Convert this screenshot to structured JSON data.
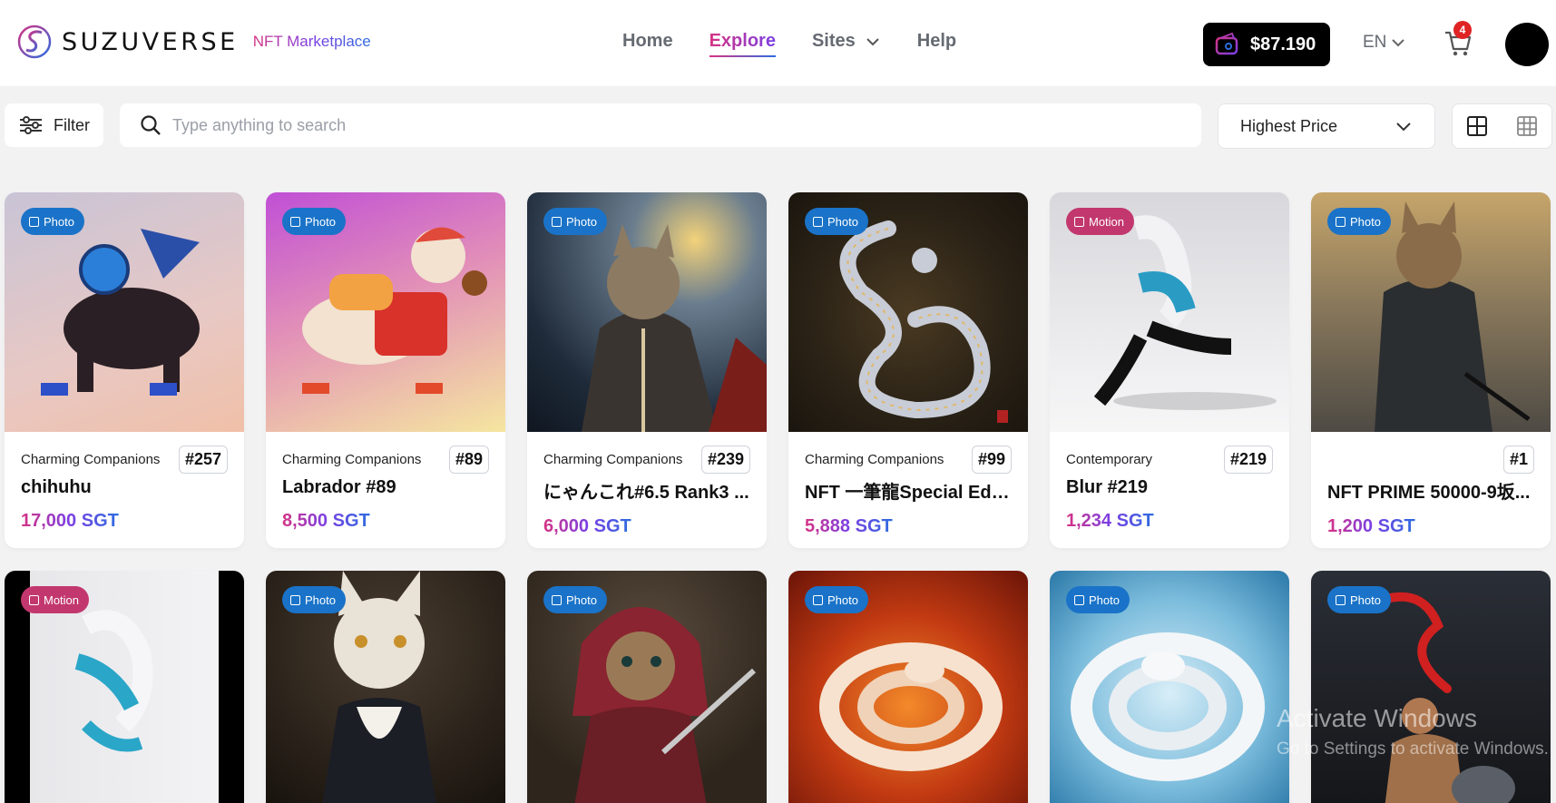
{
  "header": {
    "brand": "SUZUVERSE",
    "brand_sub": "NFT Marketplace",
    "nav": [
      {
        "label": "Home"
      },
      {
        "label": "Explore"
      },
      {
        "label": "Sites"
      },
      {
        "label": "Help"
      }
    ],
    "wallet_amount": "$87.190",
    "language": "EN",
    "cart_count": "4"
  },
  "toolbar": {
    "filter_label": "Filter",
    "search_placeholder": "Type anything to search",
    "sort_label": "Highest Price"
  },
  "cards": [
    {
      "badge": "Photo",
      "collection": "Charming Companions",
      "token": "#257",
      "title": "chihuhu",
      "price": "17,000 SGT"
    },
    {
      "badge": "Photo",
      "collection": "Charming Companions",
      "token": "#89",
      "title": "Labrador #89",
      "price": "8,500 SGT"
    },
    {
      "badge": "Photo",
      "collection": "Charming Companions",
      "token": "#239",
      "title": "にゃんこれ#6.5 Rank3 ...",
      "price": "6,000 SGT"
    },
    {
      "badge": "Photo",
      "collection": "Charming Companions",
      "token": "#99",
      "title": "NFT 一筆龍Special Edit...",
      "price": "5,888 SGT"
    },
    {
      "badge": "Motion",
      "collection": "Contemporary",
      "token": "#219",
      "title": "Blur #219",
      "price": "1,234 SGT"
    },
    {
      "badge": "Photo",
      "collection": "",
      "token": "#1",
      "title": "NFT PRIME 50000-9坂...",
      "price": "1,200 SGT"
    }
  ],
  "cards_row2": [
    {
      "badge": "Motion"
    },
    {
      "badge": "Photo"
    },
    {
      "badge": "Photo"
    },
    {
      "badge": "Photo"
    },
    {
      "badge": "Photo"
    },
    {
      "badge": "Photo"
    }
  ],
  "overlay": {
    "line1": "Activate Windows",
    "line2": "Go to Settings to activate Windows."
  },
  "colors": {
    "accent_pink": "#d63384",
    "accent_purple": "#7b3fe4",
    "accent_blue": "#2d6cdf",
    "photo_badge": "#1a73c8",
    "motion_badge": "#c2386e",
    "cart_badge": "#e02424"
  },
  "icons": [
    "logo-icon",
    "chevron-down-icon",
    "wallet-icon",
    "cart-icon",
    "filter-icon",
    "search-icon",
    "grid-large-icon",
    "grid-small-icon",
    "image-icon"
  ]
}
